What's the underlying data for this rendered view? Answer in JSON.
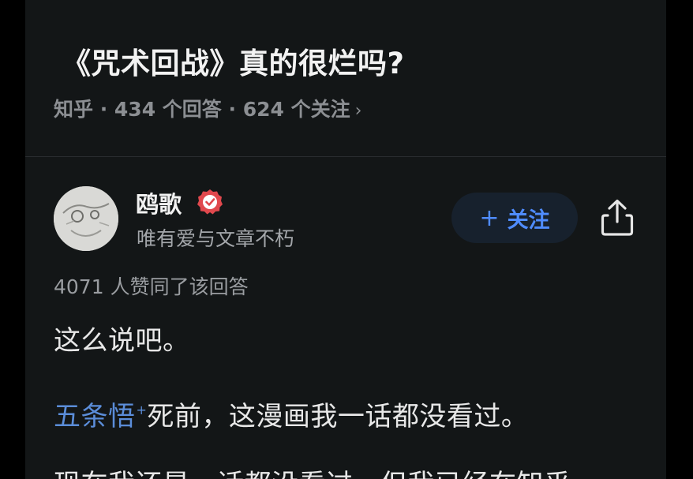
{
  "question": {
    "title": "《咒术回战》真的很烂吗?",
    "meta": "知乎 · 434 个回答 · 624 个关注",
    "meta_chevron": "›"
  },
  "author": {
    "name": "鸥歌",
    "bio": "唯有爱与文章不朽",
    "avatar_icon": "avatar-sketch",
    "verified_icon": "verified-badge-icon",
    "verified_color": "#e0484d"
  },
  "actions": {
    "follow_plus": "+",
    "follow_label": "关注",
    "share_icon": "share-icon"
  },
  "answer": {
    "upvotes": "4071 人赞同了该回答",
    "paragraph1": "这么说吧。",
    "mention": "五条悟",
    "mention_mark": "+",
    "paragraph2_rest": "死前，这漫画我一话都没看过。",
    "paragraph3_partial": "现在我还是一话都没看过，但我已经在知乎"
  },
  "colors": {
    "background": "#131617",
    "accent": "#4f8cff",
    "mention": "#5b8dd9",
    "follow_button_bg": "#17212d"
  }
}
